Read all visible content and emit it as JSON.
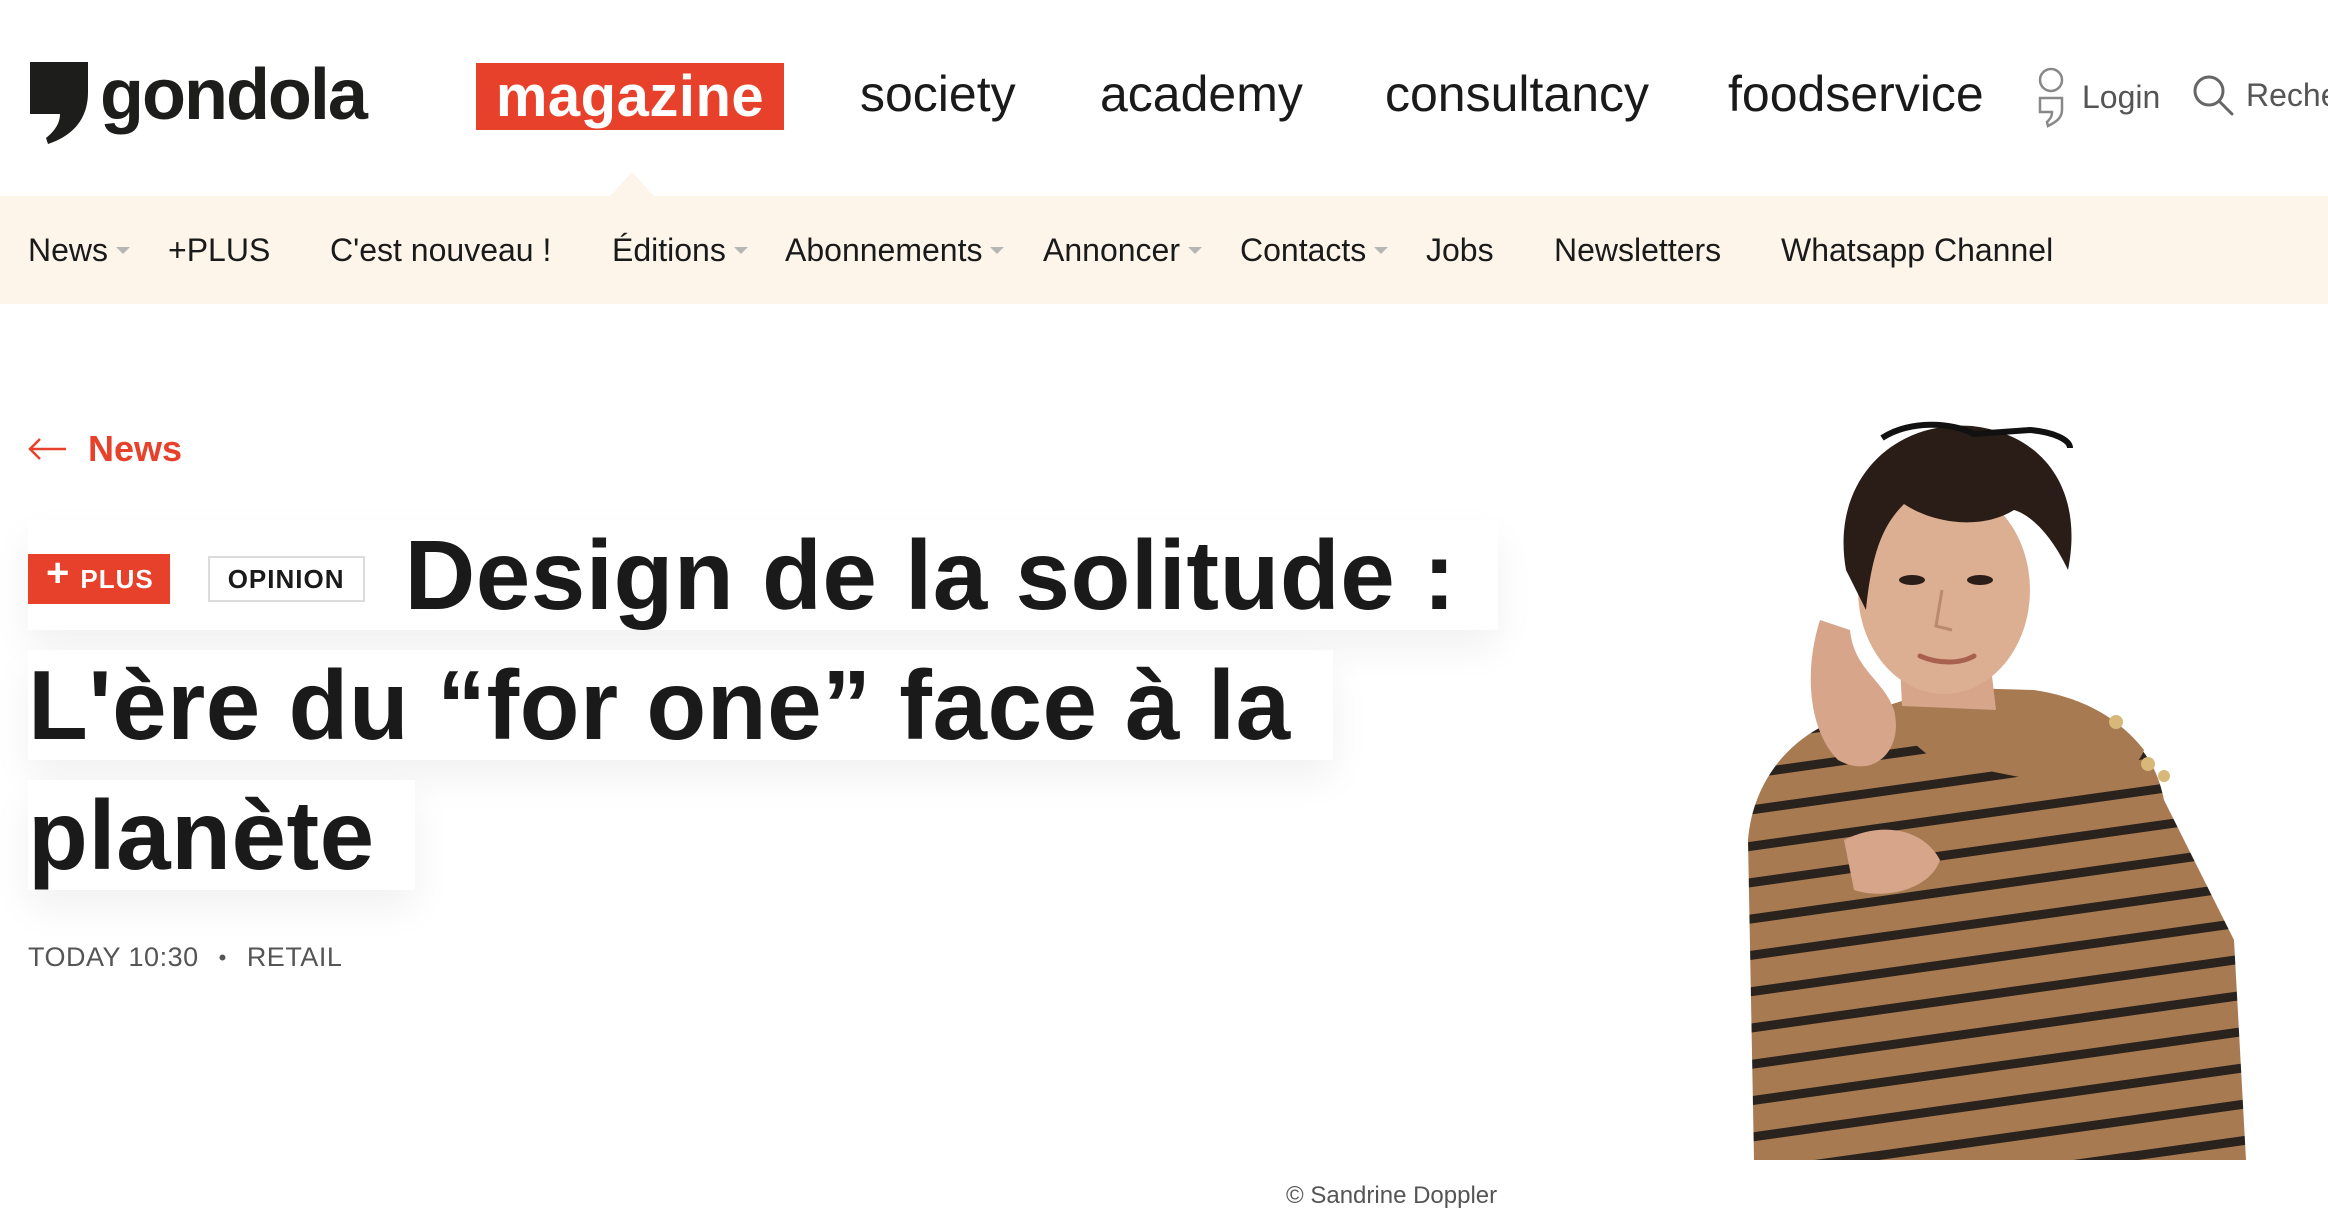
{
  "header": {
    "logo_text": "gondola",
    "magazine_label": "magazine",
    "brands": [
      "society",
      "academy",
      "consultancy",
      "foodservice"
    ],
    "login_label": "Login",
    "search_label": "Reche",
    "accent_color": "#e8412b"
  },
  "subnav": {
    "items": [
      {
        "label": "News",
        "dropdown": true
      },
      {
        "label": "+PLUS",
        "dropdown": false
      },
      {
        "label": "C'est nouveau !",
        "dropdown": false
      },
      {
        "label": "Éditions",
        "dropdown": true
      },
      {
        "label": "Abonnements",
        "dropdown": true
      },
      {
        "label": "Annoncer",
        "dropdown": true
      },
      {
        "label": "Contacts",
        "dropdown": true
      },
      {
        "label": "Jobs",
        "dropdown": false
      },
      {
        "label": "Newsletters",
        "dropdown": false
      },
      {
        "label": "Whatsapp Channel",
        "dropdown": false
      }
    ],
    "background": "#fdf5ea"
  },
  "article": {
    "back_label": "News",
    "badge_plus": "PLUS",
    "badge_opinion": "OPINION",
    "title_line1": "Design de la solitude :",
    "title_line2": "L'ère du “for one” face à la",
    "title_line3": "planète",
    "date": "TODAY 10:30",
    "separator": "•",
    "category": "RETAIL",
    "photo_credit": "© Sandrine Doppler"
  }
}
